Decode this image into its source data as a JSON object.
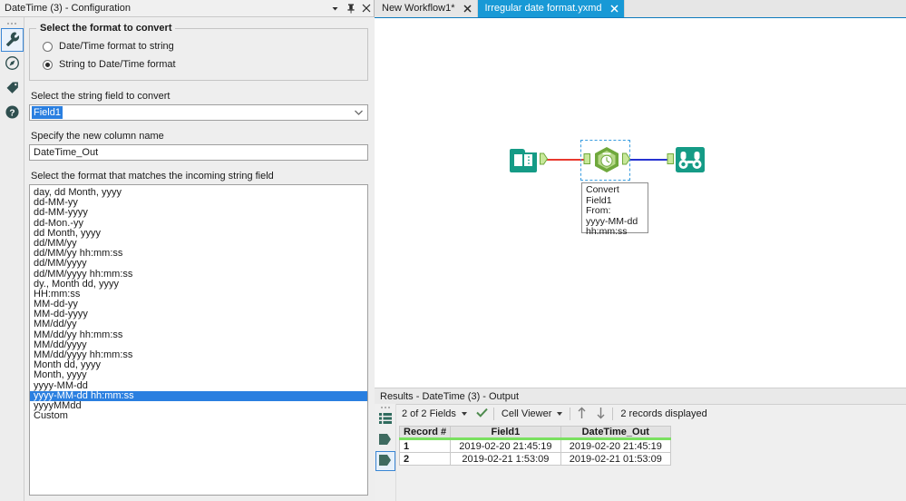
{
  "config_panel": {
    "title": "DateTime (3) - Configuration",
    "titlebar_buttons": [
      {
        "name": "dropdown-icon",
        "label": "▾"
      },
      {
        "name": "pin-icon",
        "label": "pin"
      },
      {
        "name": "close-icon",
        "label": "✕"
      }
    ],
    "rail_items": [
      {
        "name": "wrench-icon",
        "label": "Configuration",
        "active": true
      },
      {
        "name": "compass-icon",
        "label": "Annotation",
        "active": false
      },
      {
        "name": "tag-icon",
        "label": "Tags",
        "active": false
      },
      {
        "name": "help-icon",
        "label": "Help",
        "active": false
      }
    ],
    "format_group": {
      "legend": "Select the format to convert",
      "options": [
        {
          "label": "Date/Time format to string",
          "checked": false
        },
        {
          "label": "String to Date/Time format",
          "checked": true
        }
      ]
    },
    "string_field": {
      "label": "Select the string field to convert",
      "value": "Field1"
    },
    "new_column": {
      "label": "Specify the new column name",
      "value": "DateTime_Out"
    },
    "format_list": {
      "label": "Select the format that matches the incoming string field",
      "selected": "yyyy-MM-dd hh:mm:ss",
      "items": [
        "day, dd Month, yyyy",
        "dd-MM-yy",
        "dd-MM-yyyy",
        "dd-Mon.-yy",
        "dd Month, yyyy",
        "dd/MM/yy",
        "dd/MM/yy hh:mm:ss",
        "dd/MM/yyyy",
        "dd/MM/yyyy hh:mm:ss",
        "dy., Month dd, yyyy",
        "HH:mm:ss",
        "MM-dd-yy",
        "MM-dd-yyyy",
        "MM/dd/yy",
        "MM/dd/yy hh:mm:ss",
        "MM/dd/yyyy",
        "MM/dd/yyyy hh:mm:ss",
        "Month dd, yyyy",
        "Month, yyyy",
        "yyyy-MM-dd",
        "yyyy-MM-dd hh:mm:ss",
        "yyyyMMdd",
        "Custom"
      ]
    }
  },
  "tabs": [
    {
      "label": "New Workflow1*",
      "active": false
    },
    {
      "label": "Irregular date format.yxmd",
      "active": true
    }
  ],
  "canvas": {
    "tools": [
      {
        "name": "input-data-tool",
        "icon": "book-icon"
      },
      {
        "name": "datetime-tool",
        "icon": "clock-hexagon-icon",
        "selected": true
      },
      {
        "name": "browse-tool",
        "icon": "binoculars-icon"
      }
    ],
    "connections": [
      {
        "name": "connection-input-to-datetime",
        "color": "#e8392f"
      },
      {
        "name": "connection-datetime-to-browse",
        "color": "#2733d1"
      }
    ],
    "annotation": "Convert Field1\nFrom:\nyyyy-MM-dd\nhh:mm:ss"
  },
  "results": {
    "title": "Results - DateTime (3) - Output",
    "rail_items": [
      {
        "name": "list-view-icon",
        "active": false
      },
      {
        "name": "input-anchor-icon",
        "active": false
      },
      {
        "name": "output-anchor-icon",
        "active": true
      }
    ],
    "toolbar": {
      "fields_label": "2 of 2 Fields",
      "check_icon": "check-icon",
      "viewer_label": "Cell Viewer",
      "sort_asc_icon": "arrow-up-icon",
      "sort_desc_icon": "arrow-down-icon",
      "records_label": "2 records displayed"
    },
    "grid": {
      "columns": [
        "Record #",
        "Field1",
        "DateTime_Out"
      ],
      "rows": [
        [
          "1",
          "2019-02-20 21:45:19",
          "2019-02-20 21:45:19"
        ],
        [
          "2",
          "2019-02-21 1:53:09",
          "2019-02-21 01:53:09"
        ]
      ]
    }
  },
  "colors": {
    "accent_blue": "#1899d6",
    "selection_blue": "#2a7fe0",
    "tool_teal": "#159b86",
    "tool_green": "#6fa83c",
    "header_bar_green": "#7ae060",
    "conn_red": "#e8392f",
    "conn_blue": "#2733d1"
  }
}
